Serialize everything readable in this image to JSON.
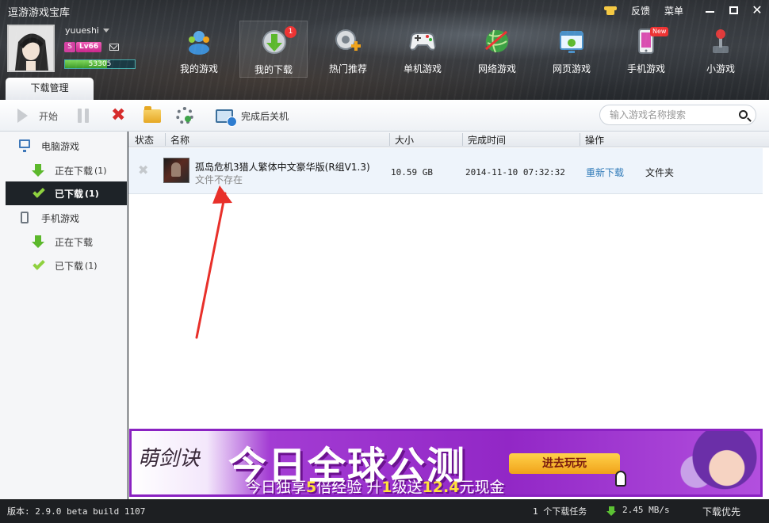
{
  "app": {
    "title": "逗游游戏宝库",
    "top_links": {
      "feedback": "反馈",
      "menu": "菜单"
    }
  },
  "user": {
    "name": "yuueshi",
    "vip_label": "S",
    "level": "Lv66",
    "exp_value": "53305",
    "exp_progress": 0.6
  },
  "topnav": [
    {
      "label": "我的游戏",
      "icon": "my-games-icon"
    },
    {
      "label": "我的下载",
      "icon": "download-icon",
      "badge": "1"
    },
    {
      "label": "热门推荐",
      "icon": "hot-recommend-icon"
    },
    {
      "label": "单机游戏",
      "icon": "gamepad-icon"
    },
    {
      "label": "网络游戏",
      "icon": "globe-icon"
    },
    {
      "label": "网页游戏",
      "icon": "web-game-icon"
    },
    {
      "label": "手机游戏",
      "icon": "mobile-icon",
      "badge": "New"
    },
    {
      "label": "小游戏",
      "icon": "joystick-icon"
    }
  ],
  "section_tab": "下载管理",
  "toolbar": {
    "start_label": "开始",
    "shutdown_label": "完成后关机",
    "search_placeholder": "输入游戏名称搜索"
  },
  "sidebar": {
    "pc": {
      "label": "电脑游戏",
      "items": [
        {
          "label": "正在下载",
          "count": "(1)"
        },
        {
          "label": "已下载",
          "count": "(1)"
        }
      ]
    },
    "mobile": {
      "label": "手机游戏",
      "items": [
        {
          "label": "正在下载",
          "count": ""
        },
        {
          "label": "已下载",
          "count": "(1)"
        }
      ]
    }
  },
  "table": {
    "columns": [
      "状态",
      "名称",
      "大小",
      "完成时间",
      "操作"
    ],
    "rows": [
      {
        "name": "孤岛危机3猎人繁体中文豪华版(R组V1.3)",
        "status": "文件不存在",
        "size": "10.59 GB",
        "completed": "2014-11-10 07:32:32",
        "action_redownload": "重新下载",
        "action_folder": "文件夹"
      }
    ]
  },
  "banner": {
    "logo": "萌剑诀",
    "headline": "今日全球公测",
    "sub_parts": [
      "今日独享",
      "5",
      "倍经验 升",
      "1",
      "级送",
      "12.4",
      "元现金"
    ],
    "button": "进去玩玩"
  },
  "statusbar": {
    "version": "版本: 2.9.0 beta build 1107",
    "tasks": "1 个下载任务",
    "speed": "2.45 MB/s",
    "priority": "下载优先"
  },
  "colors": {
    "accent": "#2f7ab8",
    "selected_bg": "#1e2328",
    "banner_purple": "#9227c6",
    "annotation_red": "#e8302a"
  }
}
